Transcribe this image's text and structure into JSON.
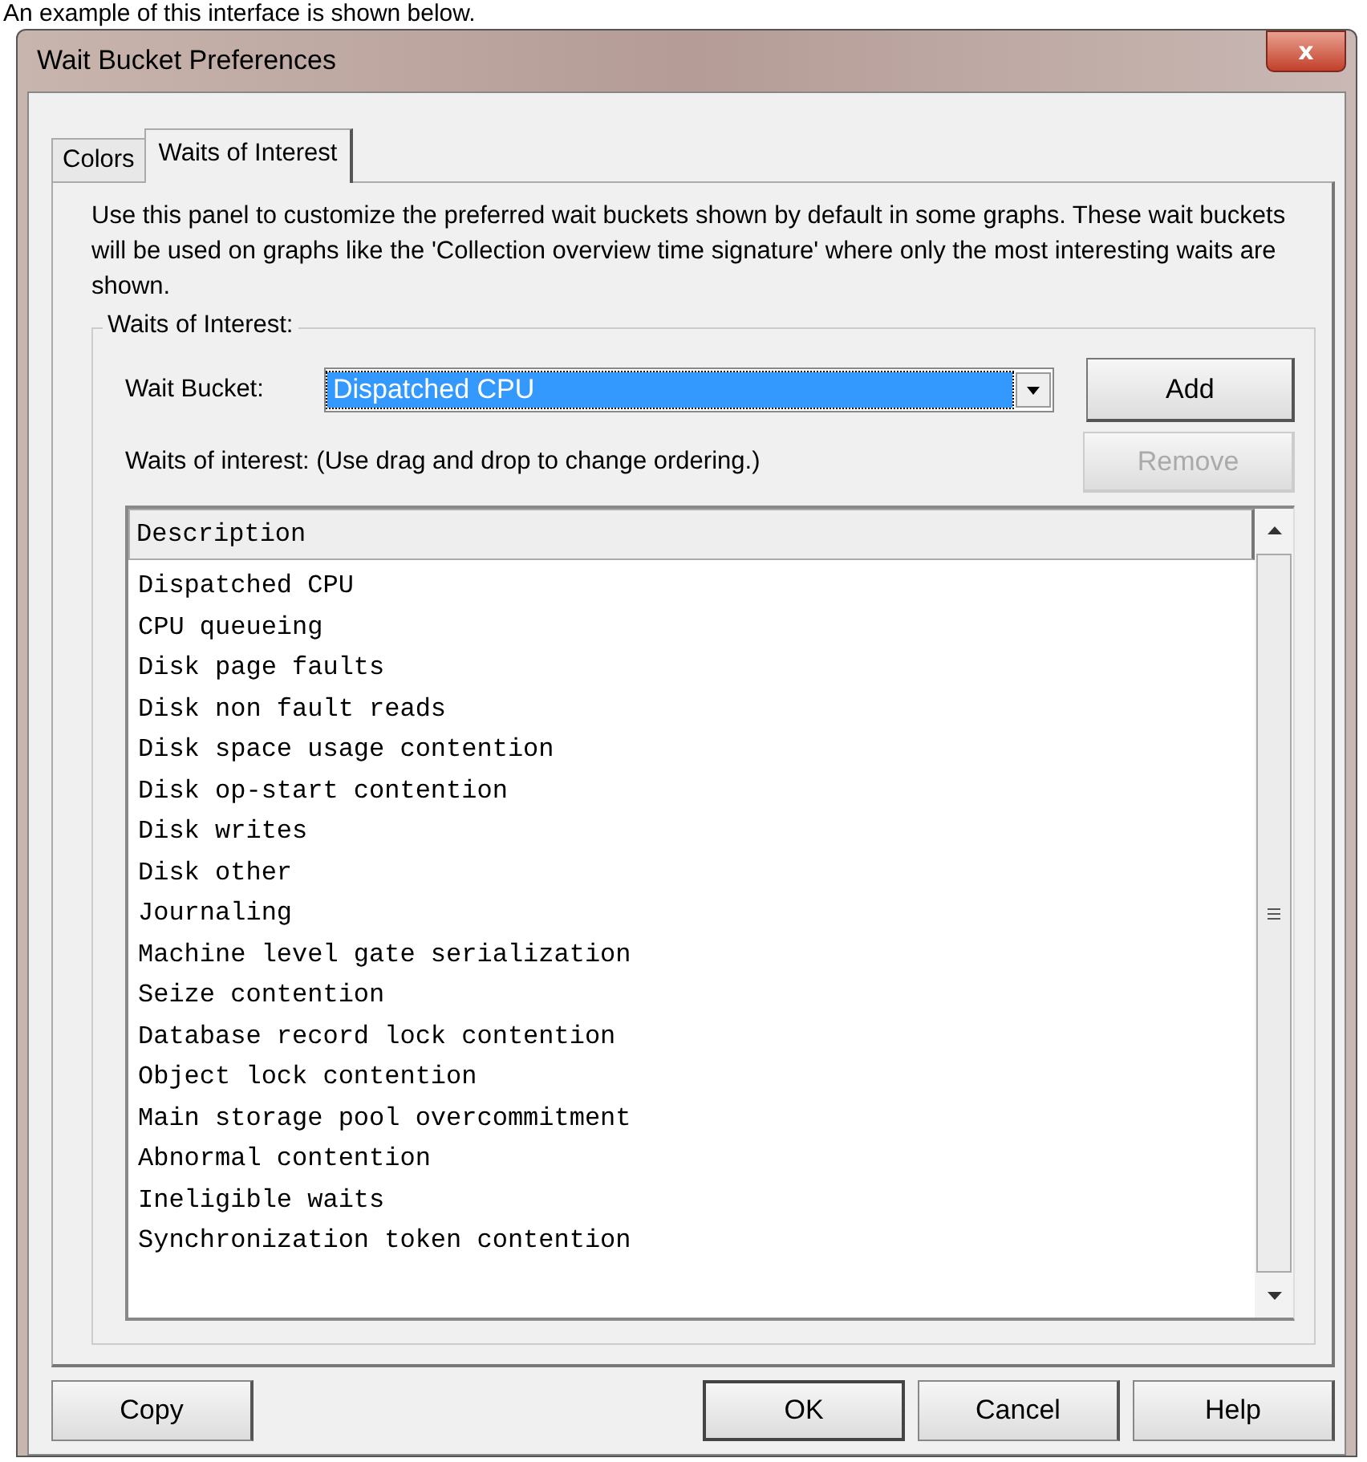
{
  "caption": "An example of this interface is shown below.",
  "window": {
    "title": "Wait Bucket Preferences",
    "close_label": "x"
  },
  "tabs": [
    {
      "label": "Colors",
      "selected": false
    },
    {
      "label": "Waits of Interest",
      "selected": true
    }
  ],
  "intro": "Use this panel to customize the preferred wait buckets shown by default in some graphs. These wait buckets will be used on graphs like the 'Collection overview time signature' where only the most interesting waits are shown.",
  "group": {
    "title": "Waits of Interest:",
    "bucket_label": "Wait Bucket:",
    "bucket_value": "Dispatched CPU",
    "list_label": "Waits of interest:  (Use drag and drop to change ordering.)",
    "buttons": [
      {
        "label": "Add",
        "disabled": false
      },
      {
        "label": "Remove",
        "disabled": true
      }
    ],
    "column": "Description",
    "rows": [
      "Dispatched CPU",
      "CPU queueing",
      "Disk page faults",
      "Disk non fault reads",
      "Disk space usage contention",
      "Disk op-start contention",
      "Disk writes",
      "Disk other",
      "Journaling",
      "Machine level gate serialization",
      "Seize contention",
      "Database record lock contention",
      "Object lock contention",
      "Main storage pool overcommitment",
      "Abnormal contention",
      "Ineligible waits",
      "Synchronization token contention"
    ]
  },
  "footer_buttons": [
    {
      "label": "Copy",
      "kind": "left",
      "default": false
    },
    {
      "label": "OK",
      "kind": "right",
      "default": true
    },
    {
      "label": "Cancel",
      "kind": "right",
      "default": false
    },
    {
      "label": "Help",
      "kind": "right",
      "default": false
    }
  ]
}
